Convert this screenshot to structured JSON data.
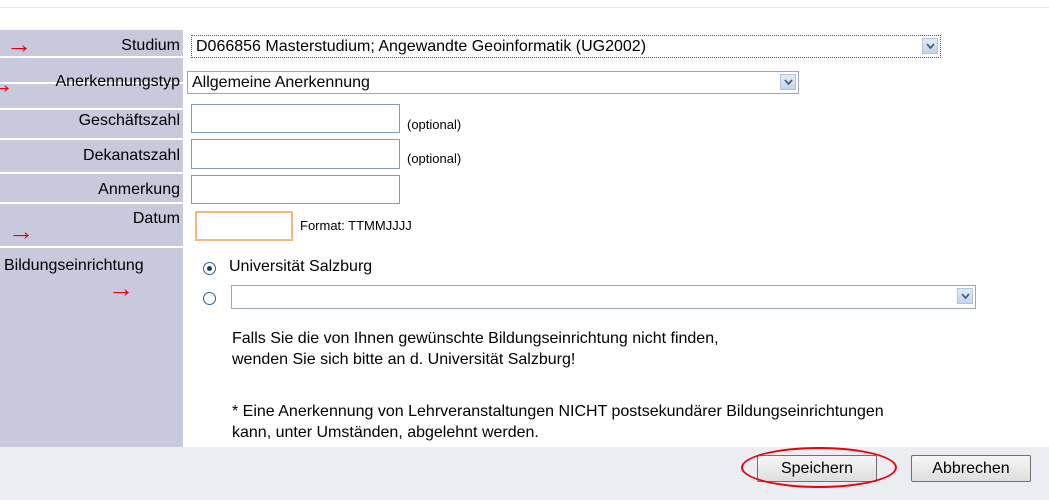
{
  "form": {
    "studium": {
      "label": "Studium",
      "value": "D066856 Masterstudium; Angewandte Geoinformatik (UG2002)"
    },
    "anerkennungstyp": {
      "label": "Anerkennungstyp",
      "value": "Allgemeine Anerkennung"
    },
    "geschaeftszahl": {
      "label": "Geschäftszahl",
      "value": "",
      "hint": "(optional)"
    },
    "dekanatszahl": {
      "label": "Dekanatszahl",
      "value": "",
      "hint": "(optional)"
    },
    "anmerkung": {
      "label": "Anmerkung",
      "value": ""
    },
    "datum": {
      "label": "Datum",
      "value": "",
      "hint": "Format: TTMMJJJJ"
    },
    "bildungseinrichtung": {
      "label": "Bildungseinrichtung",
      "option1": "Universität Salzburg",
      "option2_value": "",
      "selected": "option1"
    },
    "info_line1": "Falls Sie die von Ihnen gewünschte Bildungseinrichtung nicht finden,",
    "info_line2": "wenden Sie sich bitte an d. Universität Salzburg!",
    "note_line1": "* Eine Anerkennung von Lehrveranstaltungen NICHT postsekundärer Bildungseinrichtungen",
    "note_line2": "kann, unter Umständen, abgelehnt werden."
  },
  "buttons": {
    "save": "Speichern",
    "cancel": "Abbrechen"
  },
  "annotations": {
    "arrow_color": "#e8000b",
    "arrow_glyph": "→"
  },
  "colors": {
    "label_column": "#c9c9de",
    "focus_border": "#f3b97a",
    "highlight": "#e8000b"
  }
}
